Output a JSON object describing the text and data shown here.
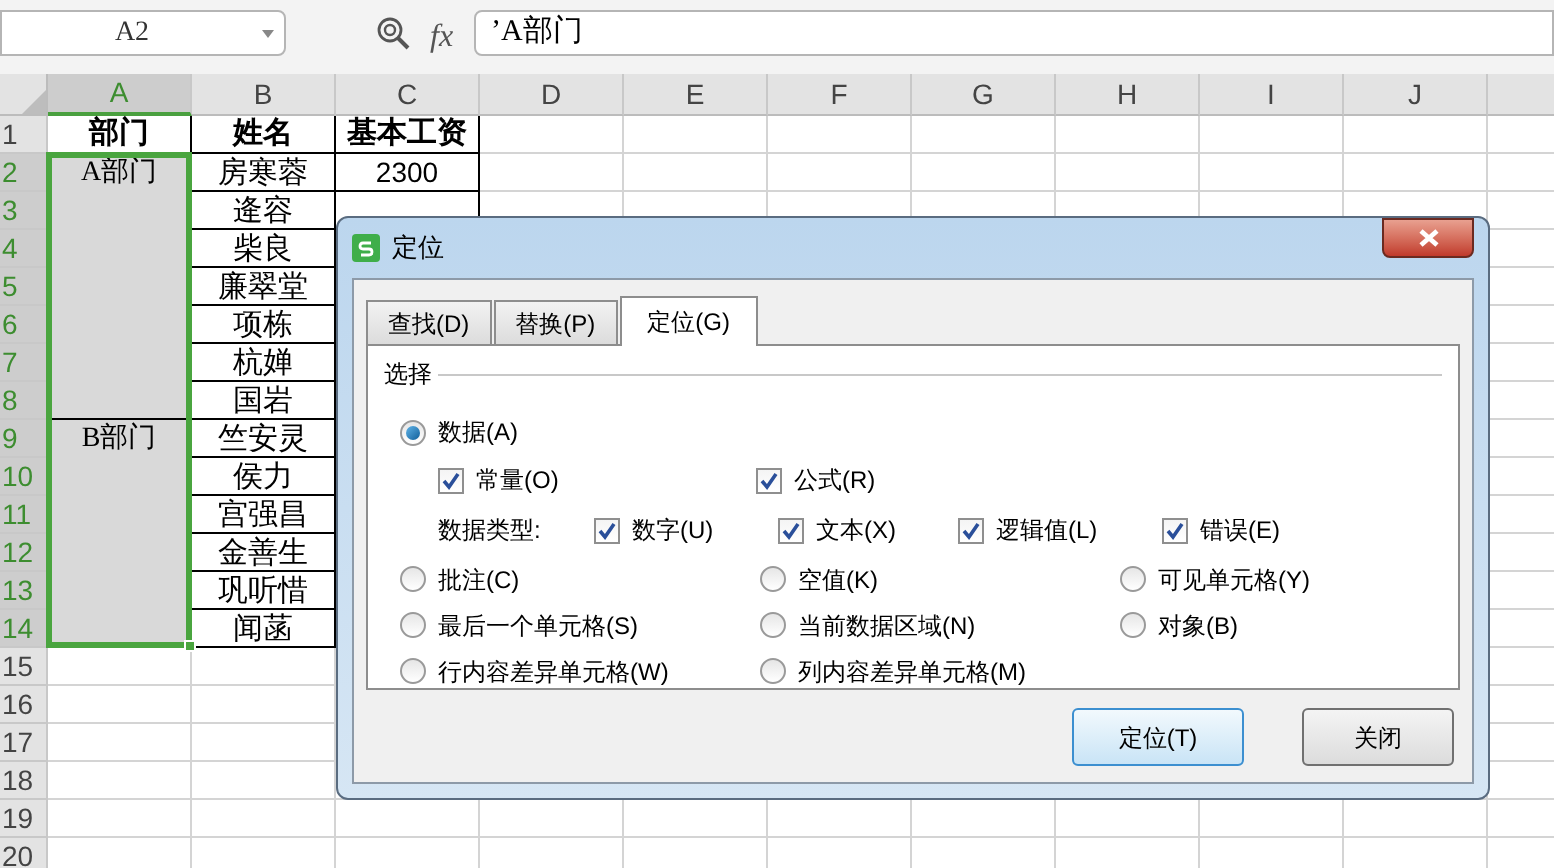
{
  "name_box": {
    "value": "A2"
  },
  "formula_bar": {
    "fx_label": "fx",
    "value": "’A部门"
  },
  "columns": [
    {
      "label": "A",
      "selected": true
    },
    {
      "label": "B",
      "selected": false
    },
    {
      "label": "C",
      "selected": false
    },
    {
      "label": "D",
      "selected": false
    },
    {
      "label": "E",
      "selected": false
    },
    {
      "label": "F",
      "selected": false
    },
    {
      "label": "G",
      "selected": false
    },
    {
      "label": "H",
      "selected": false
    },
    {
      "label": "I",
      "selected": false
    },
    {
      "label": "J",
      "selected": false
    }
  ],
  "row_headers": [
    {
      "label": "1",
      "selected": false
    },
    {
      "label": "2",
      "selected": true
    },
    {
      "label": "3",
      "selected": true
    },
    {
      "label": "4",
      "selected": true
    },
    {
      "label": "5",
      "selected": true
    },
    {
      "label": "6",
      "selected": true
    },
    {
      "label": "7",
      "selected": true
    },
    {
      "label": "8",
      "selected": true
    },
    {
      "label": "9",
      "selected": true
    },
    {
      "label": "10",
      "selected": true
    },
    {
      "label": "11",
      "selected": true
    },
    {
      "label": "12",
      "selected": true
    },
    {
      "label": "13",
      "selected": true
    },
    {
      "label": "14",
      "selected": true
    },
    {
      "label": "15",
      "selected": false
    },
    {
      "label": "16",
      "selected": false
    },
    {
      "label": "17",
      "selected": false
    },
    {
      "label": "18",
      "selected": false
    },
    {
      "label": "19",
      "selected": false
    },
    {
      "label": "20",
      "selected": false
    }
  ],
  "table_header": [
    "部门",
    "姓名",
    "基本工资"
  ],
  "departments": [
    {
      "name": "A部门",
      "selected": true,
      "members": [
        {
          "name": "房寒蓉",
          "salary": "2300"
        },
        {
          "name": "逄容"
        },
        {
          "name": "柴良"
        },
        {
          "name": "廉翠堂"
        },
        {
          "name": "项栋"
        },
        {
          "name": "杭婵"
        },
        {
          "name": "国岩"
        }
      ]
    },
    {
      "name": "B部门",
      "selected": true,
      "members": [
        {
          "name": "竺安灵"
        },
        {
          "name": "侯力"
        },
        {
          "name": "宫强昌"
        },
        {
          "name": "金善生"
        },
        {
          "name": "巩听惜"
        },
        {
          "name": "闻菡"
        }
      ]
    }
  ],
  "dialog": {
    "title": "定位",
    "tabs": [
      {
        "label": "查找(D)",
        "selected": false
      },
      {
        "label": "替换(P)",
        "selected": false
      },
      {
        "label": "定位(G)",
        "selected": true
      }
    ],
    "group_label": "选择",
    "data_option": {
      "label": "数据(A)",
      "selected": true
    },
    "data_checks": [
      {
        "label": "常量(O)",
        "checked": true
      },
      {
        "label": "公式(R)",
        "checked": true
      }
    ],
    "data_type_label": "数据类型:",
    "data_types": [
      {
        "label": "数字(U)",
        "checked": true
      },
      {
        "label": "文本(X)",
        "checked": true
      },
      {
        "label": "逻辑值(L)",
        "checked": true
      },
      {
        "label": "错误(E)",
        "checked": true
      }
    ],
    "options": [
      {
        "label": "批注(C)",
        "selected": false
      },
      {
        "label": "空值(K)",
        "selected": false
      },
      {
        "label": "可见单元格(Y)",
        "selected": false
      },
      {
        "label": "最后一个单元格(S)",
        "selected": false
      },
      {
        "label": "当前数据区域(N)",
        "selected": false
      },
      {
        "label": "对象(B)",
        "selected": false
      },
      {
        "label": "行内容差异单元格(W)",
        "selected": false
      },
      {
        "label": "列内容差异单元格(M)",
        "selected": false
      }
    ],
    "buttons": [
      {
        "label": "定位(T)",
        "default": true
      },
      {
        "label": "关闭",
        "default": false
      }
    ]
  }
}
